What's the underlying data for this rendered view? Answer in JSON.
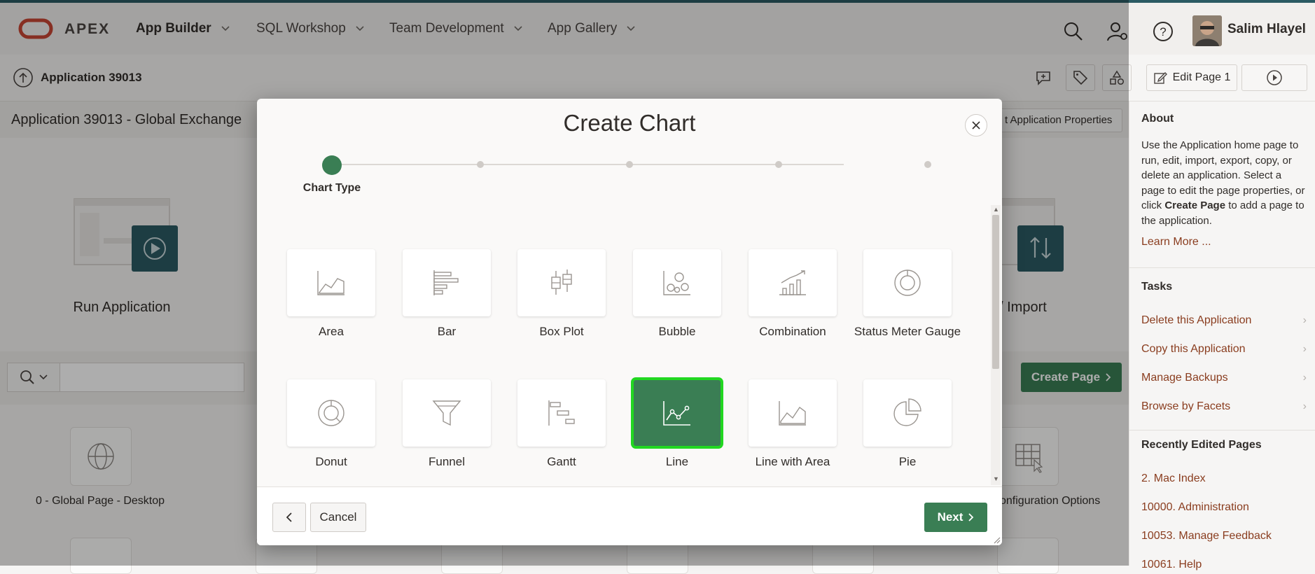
{
  "topnav": {
    "logo_text": "APEX",
    "items": [
      {
        "label": "App Builder"
      },
      {
        "label": "SQL Workshop"
      },
      {
        "label": "Team Development"
      },
      {
        "label": "App Gallery"
      }
    ],
    "user_name": "Salim Hlayel"
  },
  "subbar": {
    "app_label": "Application 39013",
    "edit_page_label": "Edit Page 1"
  },
  "page": {
    "title": "Application 39013 - Global Exchange",
    "edit_props_label": "t Application Properties",
    "run_application_label": "Run Application",
    "import_label": "/ Import",
    "create_page_label": "Create Page",
    "page_tile_label": "0 - Global Page - Desktop",
    "config_options_label": "onfiguration Options"
  },
  "sidebar": {
    "about_heading": "About",
    "about_text_1": "Use the Application home page to run, edit, import, export, copy, or delete an application. Select a page to edit the page properties, or click ",
    "about_text_bold": "Create Page",
    "about_text_2": " to add a page to the application.",
    "learn_more": "Learn More ...",
    "tasks_heading": "Tasks",
    "tasks": [
      {
        "label": "Delete this Application"
      },
      {
        "label": "Copy this Application"
      },
      {
        "label": "Manage Backups"
      },
      {
        "label": "Browse by Facets"
      }
    ],
    "recent_heading": "Recently Edited Pages",
    "recent": [
      {
        "label": "2. Mac Index"
      },
      {
        "label": "10000. Administration"
      },
      {
        "label": "10053. Manage Feedback"
      },
      {
        "label": "10061. Help"
      }
    ]
  },
  "dialog": {
    "title": "Create Chart",
    "current_step_label": "Chart Type",
    "chart_types": [
      {
        "label": "Area",
        "icon": "area-chart-icon"
      },
      {
        "label": "Bar",
        "icon": "bar-chart-icon"
      },
      {
        "label": "Box Plot",
        "icon": "box-plot-icon"
      },
      {
        "label": "Bubble",
        "icon": "bubble-chart-icon"
      },
      {
        "label": "Combination",
        "icon": "combination-chart-icon"
      },
      {
        "label": "Status Meter Gauge",
        "icon": "gauge-icon"
      },
      {
        "label": "Donut",
        "icon": "donut-chart-icon"
      },
      {
        "label": "Funnel",
        "icon": "funnel-chart-icon"
      },
      {
        "label": "Gantt",
        "icon": "gantt-chart-icon"
      },
      {
        "label": "Line",
        "icon": "line-chart-icon",
        "selected": true
      },
      {
        "label": "Line with Area",
        "icon": "line-area-chart-icon"
      },
      {
        "label": "Pie",
        "icon": "pie-chart-icon"
      }
    ],
    "cancel_label": "Cancel",
    "next_label": "Next"
  },
  "colors": {
    "accent_green": "#3a7e54",
    "selection_outline": "#21d721",
    "link": "#8a3d1f",
    "teal_tile": "#2b5a63"
  }
}
